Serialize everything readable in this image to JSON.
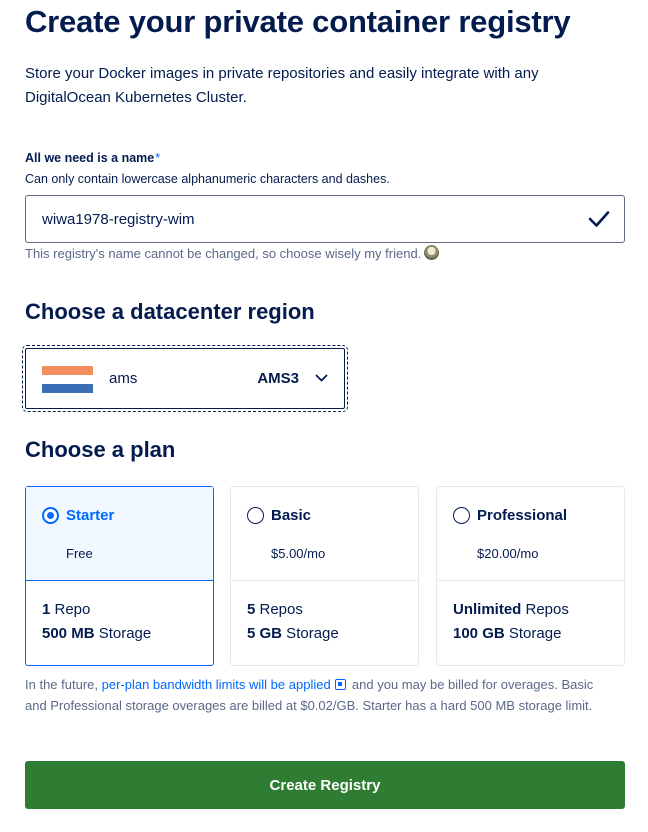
{
  "header": {
    "title": "Create your private container registry",
    "subtitle": "Store your Docker images in private repositories and easily integrate with any DigitalOcean Kubernetes Cluster."
  },
  "name_field": {
    "label": "All we need is a name",
    "required_mark": "*",
    "help": "Can only contain lowercase alphanumeric characters and dashes.",
    "value": "wiwa1978-registry-wim",
    "note": "This registry's name cannot be changed, so choose wisely my friend.",
    "valid_icon": "checkmark-icon",
    "note_icon": "moon-emoji-icon"
  },
  "region": {
    "heading": "Choose a datacenter region",
    "selected": {
      "name": "ams",
      "code": "AMS3",
      "flag": "netherlands-flag-icon"
    },
    "colors": {
      "flag_top": "#f28e5e",
      "flag_middle": "#ffffff",
      "flag_bottom": "#3b6fb5"
    }
  },
  "plans": {
    "heading": "Choose a plan",
    "items": [
      {
        "name": "Starter",
        "price": "Free",
        "selected": true,
        "repos_value": "1",
        "repos_label": " Repo",
        "storage_value": "500 MB",
        "storage_label": " Storage"
      },
      {
        "name": "Basic",
        "price": "$5.00/mo",
        "selected": false,
        "repos_value": "5",
        "repos_label": " Repos",
        "storage_value": "5 GB",
        "storage_label": " Storage"
      },
      {
        "name": "Professional",
        "price": "$20.00/mo",
        "selected": false,
        "repos_value": "Unlimited",
        "repos_label": " Repos",
        "storage_value": "100 GB",
        "storage_label": " Storage"
      }
    ]
  },
  "footnote": {
    "prefix": "In the future, ",
    "link_text": "per-plan bandwidth limits will be applied",
    "link_icon": "external-link-icon",
    "suffix": " and you may be billed for overages. Basic and Professional storage overages are billed at $0.02/GB. Starter has a hard 500 MB storage limit."
  },
  "actions": {
    "create_label": "Create Registry"
  },
  "colors": {
    "text": "#031b4e",
    "muted": "#5b6987",
    "accent": "#0069ff",
    "primary_button": "#2e7d32",
    "selected_bg": "#f2f8ff"
  }
}
